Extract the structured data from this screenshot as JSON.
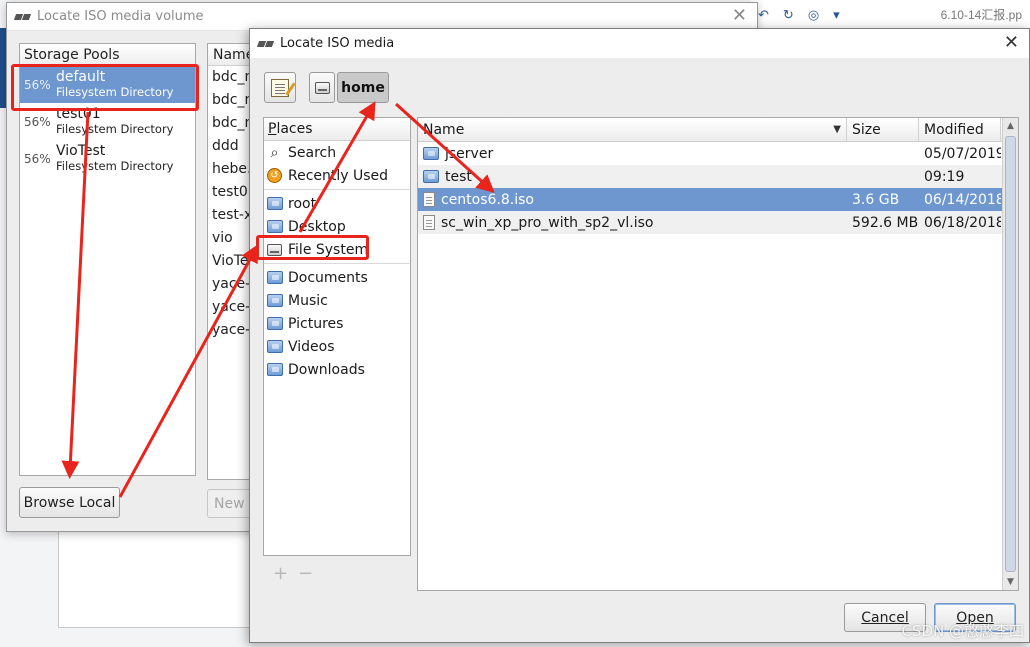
{
  "background_app": {
    "toolbar_icons": [
      "undo-icon",
      "refresh-icon",
      "camera-icon",
      "dropdown-icon"
    ],
    "document_title": "6.10-14汇报.pp"
  },
  "volume_dialog": {
    "title": "Locate ISO media volume",
    "pools_header": "Storage Pools",
    "pools": [
      {
        "percent": "56%",
        "name": "default",
        "type": "Filesystem Directory",
        "selected": true
      },
      {
        "percent": "56%",
        "name": "test01",
        "type": "Filesystem Directory",
        "selected": false
      },
      {
        "percent": "56%",
        "name": "VioTest",
        "type": "Filesystem Directory",
        "selected": false
      }
    ],
    "volumes_header": "Name",
    "volumes": [
      "bdc_n",
      "bdc_n",
      "bdc_n",
      "ddd",
      "hebe.",
      "test0",
      "test-x",
      "vio",
      "VioTe",
      "yace-",
      "yace-",
      "yace-"
    ],
    "browse_local_label": "Browse Local",
    "new_volume_label": "New V"
  },
  "iso_dialog": {
    "title": "Locate ISO media",
    "path": {
      "root_icon": "drive-icon",
      "current": "home"
    },
    "places_header": "Places",
    "places_group1": [
      {
        "label": "Search",
        "icon": "search-icon"
      },
      {
        "label": "Recently Used",
        "icon": "recent-icon"
      }
    ],
    "places_group2": [
      {
        "label": "root",
        "icon": "home-folder-icon"
      },
      {
        "label": "Desktop",
        "icon": "desktop-folder-icon"
      },
      {
        "label": "File System",
        "icon": "drive-icon"
      }
    ],
    "places_group3": [
      {
        "label": "Documents",
        "icon": "documents-folder-icon"
      },
      {
        "label": "Music",
        "icon": "music-folder-icon"
      },
      {
        "label": "Pictures",
        "icon": "pictures-folder-icon"
      },
      {
        "label": "Videos",
        "icon": "videos-folder-icon"
      },
      {
        "label": "Downloads",
        "icon": "downloads-folder-icon"
      }
    ],
    "columns": {
      "name": "Name",
      "size": "Size",
      "modified": "Modified"
    },
    "files": [
      {
        "name": "jserver",
        "size": "",
        "modified": "05/07/2019",
        "kind": "folder",
        "selected": false
      },
      {
        "name": "test",
        "size": "",
        "modified": "09:19",
        "kind": "folder",
        "selected": false
      },
      {
        "name": "centos6.8.iso",
        "size": "3.6 GB",
        "modified": "06/14/2018",
        "kind": "file",
        "selected": true
      },
      {
        "name": "sc_win_xp_pro_with_sp2_vl.iso",
        "size": "592.6 MB",
        "modified": "06/18/2018",
        "kind": "file",
        "selected": false
      }
    ],
    "cancel_label": "Cancel",
    "open_label": "Open"
  },
  "watermark": "CSDN @憨憨李四",
  "colors": {
    "selection": "#6e97cf",
    "annotation_red": "#e8241c"
  }
}
